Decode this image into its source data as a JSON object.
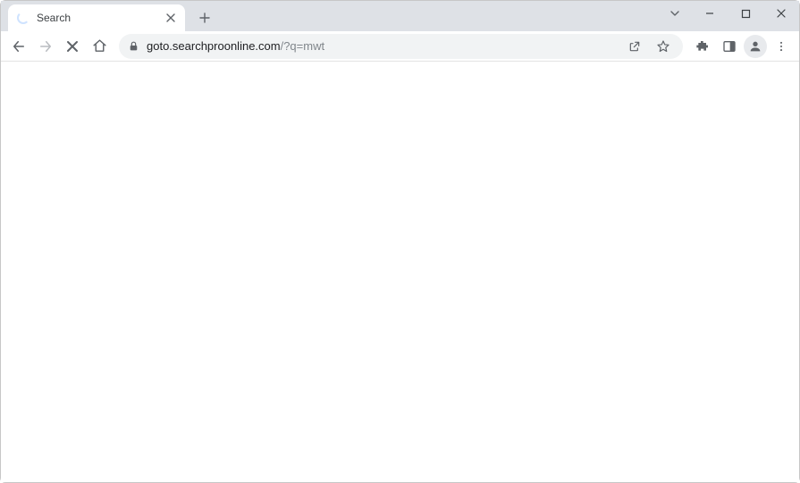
{
  "tab": {
    "title": "Search"
  },
  "omnibox": {
    "host": "goto.searchproonline.com",
    "rest": "/?q=mwt"
  }
}
